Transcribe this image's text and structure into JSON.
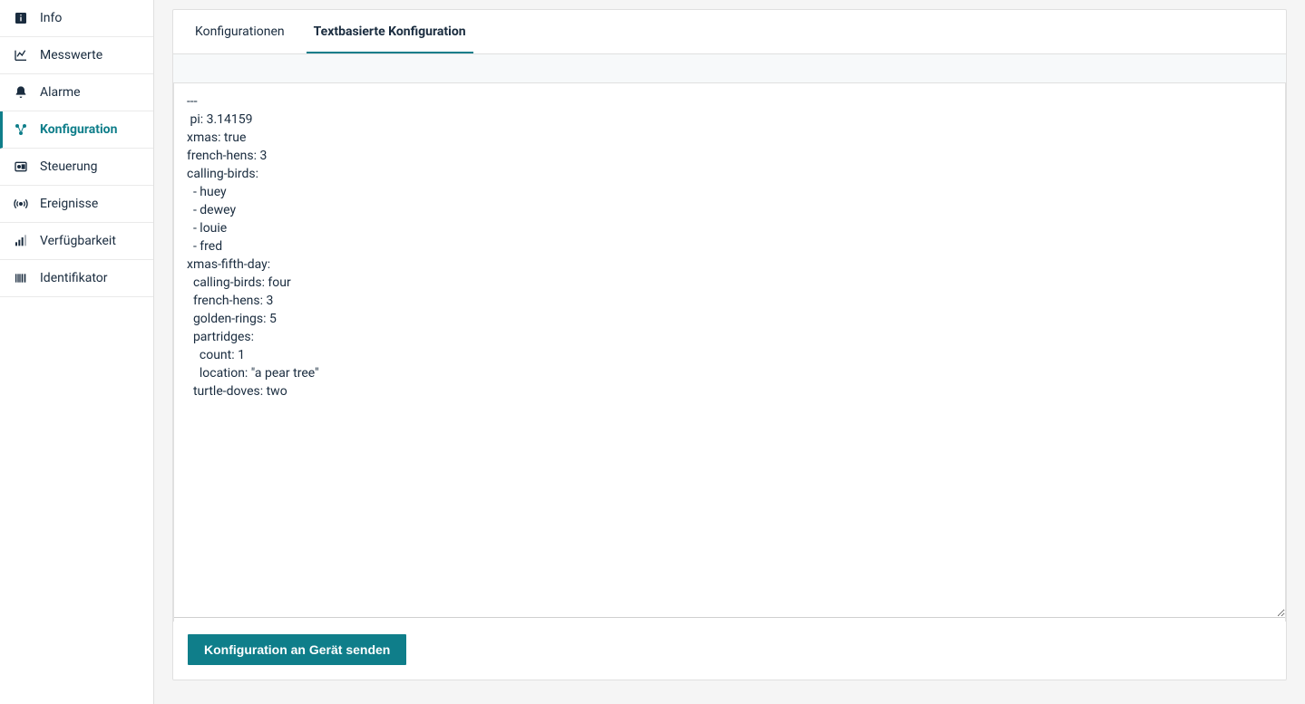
{
  "sidebar": {
    "items": [
      {
        "label": "Info",
        "icon": "info-box-icon",
        "active": false
      },
      {
        "label": "Messwerte",
        "icon": "chart-line-icon",
        "active": false
      },
      {
        "label": "Alarme",
        "icon": "bell-icon",
        "active": false
      },
      {
        "label": "Konfiguration",
        "icon": "settings-nodes-icon",
        "active": true
      },
      {
        "label": "Steuerung",
        "icon": "control-panel-icon",
        "active": false
      },
      {
        "label": "Ereignisse",
        "icon": "broadcast-icon",
        "active": false
      },
      {
        "label": "Verfügbarkeit",
        "icon": "bars-signal-icon",
        "active": false
      },
      {
        "label": "Identifikator",
        "icon": "barcode-icon",
        "active": false
      }
    ]
  },
  "tabs": [
    {
      "label": "Konfigurationen",
      "active": false
    },
    {
      "label": "Textbasierte Konfiguration",
      "active": true
    }
  ],
  "editor": {
    "value": "---\n pi: 3.14159\nxmas: true\nfrench-hens: 3\ncalling-birds:\n  - huey\n  - dewey\n  - louie\n  - fred\nxmas-fifth-day:\n  calling-birds: four\n  french-hens: 3\n  golden-rings: 5\n  partridges:\n    count: 1\n    location: \"a pear tree\"\n  turtle-doves: two"
  },
  "actions": {
    "send_label": "Konfiguration an Gerät senden"
  },
  "colors": {
    "accent": "#0f7e8a"
  }
}
